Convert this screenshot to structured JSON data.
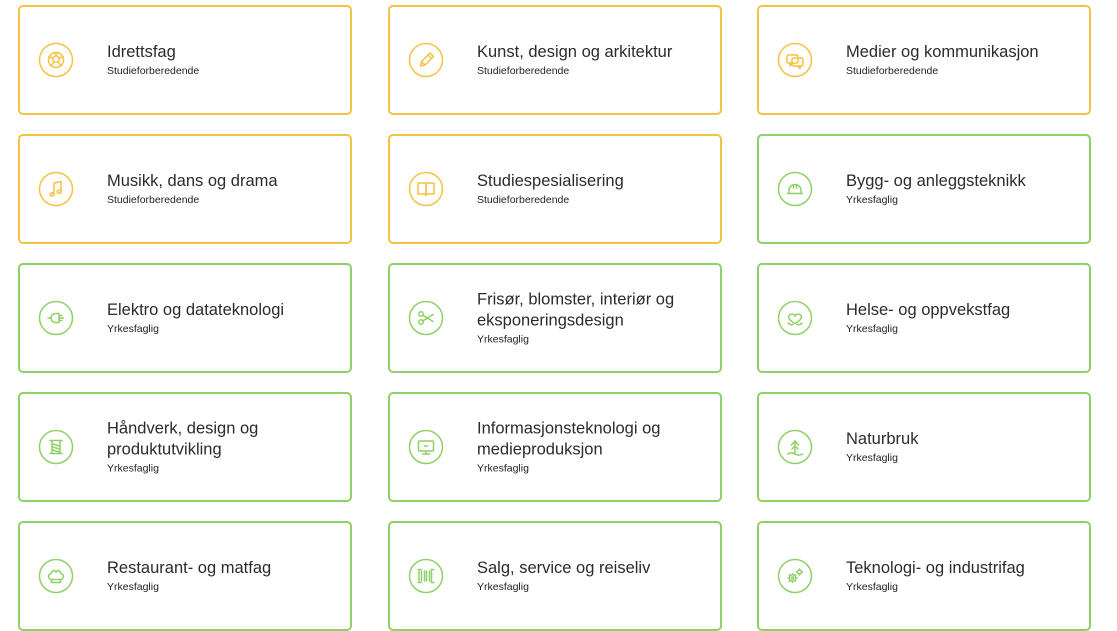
{
  "programs": [
    {
      "title": "Idrettsfag",
      "category": "Studieforberedende",
      "icon": "football-icon",
      "color": "#f5c243"
    },
    {
      "title": "Kunst, design og arkitektur",
      "category": "Studieforberedende",
      "icon": "pencil-icon",
      "color": "#f5c243"
    },
    {
      "title": "Medier og kommunikasjon",
      "category": "Studieforberedende",
      "icon": "chat-bubbles-icon",
      "color": "#f5c243"
    },
    {
      "title": "Musikk, dans og drama",
      "category": "Studieforberedende",
      "icon": "music-note-icon",
      "color": "#f5c243"
    },
    {
      "title": "Studiespesialisering",
      "category": "Studieforberedende",
      "icon": "open-book-icon",
      "color": "#f5c243"
    },
    {
      "title": "Bygg- og anleggsteknikk",
      "category": "Yrkesfaglig",
      "icon": "hard-hat-icon",
      "color": "#8fd067"
    },
    {
      "title": "Elektro og datateknologi",
      "category": "Yrkesfaglig",
      "icon": "plug-icon",
      "color": "#8fd067"
    },
    {
      "title": "Frisør, blomster, interiør og\neksponeringsdesign",
      "category": "Yrkesfaglig",
      "icon": "scissors-icon",
      "color": "#8fd067"
    },
    {
      "title": "Helse- og oppvekstfag",
      "category": "Yrkesfaglig",
      "icon": "heart-hands-icon",
      "color": "#8fd067"
    },
    {
      "title": "Håndverk, design og\nproduktutvikling",
      "category": "Yrkesfaglig",
      "icon": "spool-icon",
      "color": "#8fd067"
    },
    {
      "title": "Informasjonsteknologi og\nmedieproduksjon",
      "category": "Yrkesfaglig",
      "icon": "monitor-icon",
      "color": "#8fd067"
    },
    {
      "title": "Naturbruk",
      "category": "Yrkesfaglig",
      "icon": "tree-icon",
      "color": "#8fd067"
    },
    {
      "title": "Restaurant- og matfag",
      "category": "Yrkesfaglig",
      "icon": "chef-hat-icon",
      "color": "#8fd067"
    },
    {
      "title": "Salg, service og reiseliv",
      "category": "Yrkesfaglig",
      "icon": "barcode-icon",
      "color": "#8fd067"
    },
    {
      "title": "Teknologi- og industrifag",
      "category": "Yrkesfaglig",
      "icon": "gears-icon",
      "color": "#8fd067"
    }
  ]
}
